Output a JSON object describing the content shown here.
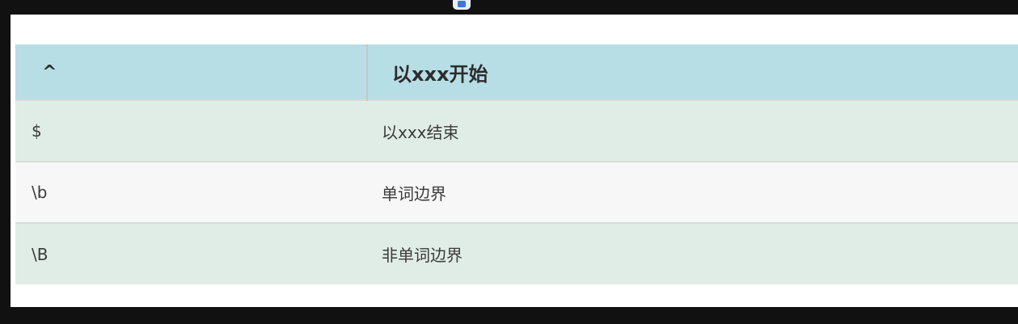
{
  "table": {
    "headers": [
      "^",
      "以xxx开始"
    ],
    "rows": [
      [
        "$",
        "以xxx结束"
      ],
      [
        "\\b",
        "单词边界"
      ],
      [
        "\\B",
        "非单词边界"
      ]
    ]
  },
  "colors": {
    "header_bg": "#b7dee5",
    "row_odd_bg": "#e0ede6",
    "row_even_bg": "#f7f7f7",
    "frame_bg": "#111111"
  }
}
